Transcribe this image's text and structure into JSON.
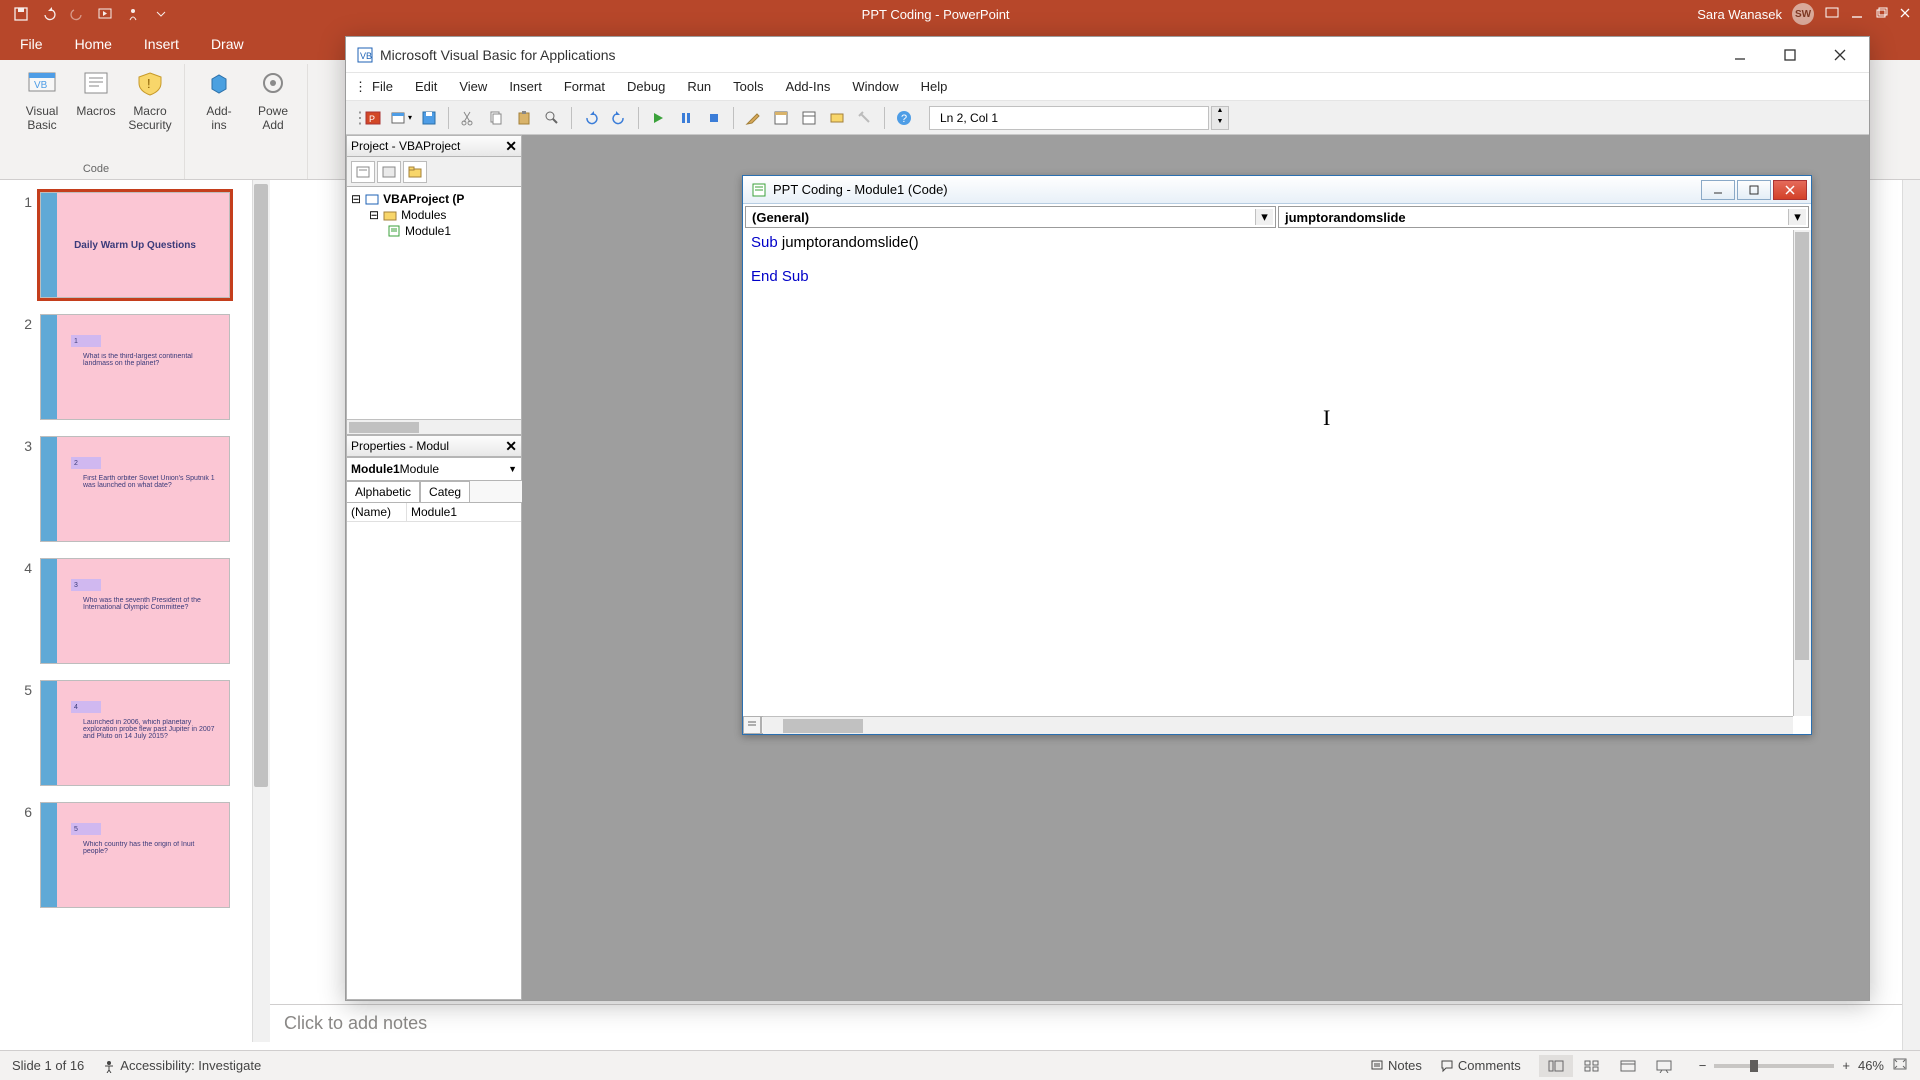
{
  "pp": {
    "title": "PPT Coding  -  PowerPoint",
    "user_name": "Sara Wanasek",
    "user_initials": "SW",
    "tabs": [
      "File",
      "Home",
      "Insert",
      "Draw"
    ],
    "ribbon": {
      "group1_label": "Code",
      "btn_vb": "Visual\nBasic",
      "btn_macros": "Macros",
      "btn_macrosec": "Macro\nSecurity",
      "btn_addins": "Add-\nins",
      "btn_ppadd": "Powe\nAdd"
    },
    "slides": [
      {
        "n": "1",
        "title": "Daily Warm Up Questions",
        "selected": true,
        "q": ""
      },
      {
        "n": "2",
        "title": "",
        "q": "1",
        "text": "What is the third-largest continental landmass on the planet?"
      },
      {
        "n": "3",
        "title": "",
        "q": "2",
        "text": "First Earth orbiter Soviet Union's Sputnik 1 was launched on what date?"
      },
      {
        "n": "4",
        "title": "",
        "q": "3",
        "text": "Who was the seventh President of the International Olympic Committee?"
      },
      {
        "n": "5",
        "title": "",
        "q": "4",
        "text": "Launched in 2006, which planetary exploration probe flew past Jupiter in 2007 and Pluto on 14 July 2015?"
      },
      {
        "n": "6",
        "title": "",
        "q": "5",
        "text": "Which country has the origin of Inuit people?"
      }
    ],
    "notes_placeholder": "Click to add notes",
    "status": {
      "slide": "Slide 1 of 16",
      "accessibility": "Accessibility: Investigate",
      "notes": "Notes",
      "comments": "Comments",
      "zoom": "46%"
    }
  },
  "vba": {
    "window_title": "Microsoft Visual Basic for Applications",
    "menu": [
      "File",
      "Edit",
      "View",
      "Insert",
      "Format",
      "Debug",
      "Run",
      "Tools",
      "Add-Ins",
      "Window",
      "Help"
    ],
    "lncol": "Ln 2, Col 1",
    "project_panel_title": "Project - VBAProject",
    "project_tree": {
      "root": "VBAProject (P",
      "modules": "Modules",
      "module1": "Module1"
    },
    "properties_panel_title": "Properties - Modul",
    "properties_combo": "Module1",
    "properties_combo_suffix": " Module",
    "properties_tabs": [
      "Alphabetic",
      "Categ"
    ],
    "properties_name_label": "(Name)",
    "properties_name_value": "Module1",
    "code_window_title": "PPT Coding - Module1 (Code)",
    "combo_left": "(General)",
    "combo_right": "jumptorandomslide",
    "code_line1_kw": "Sub ",
    "code_line1_rest": "jumptorandomslide()",
    "code_line3": "End Sub"
  }
}
